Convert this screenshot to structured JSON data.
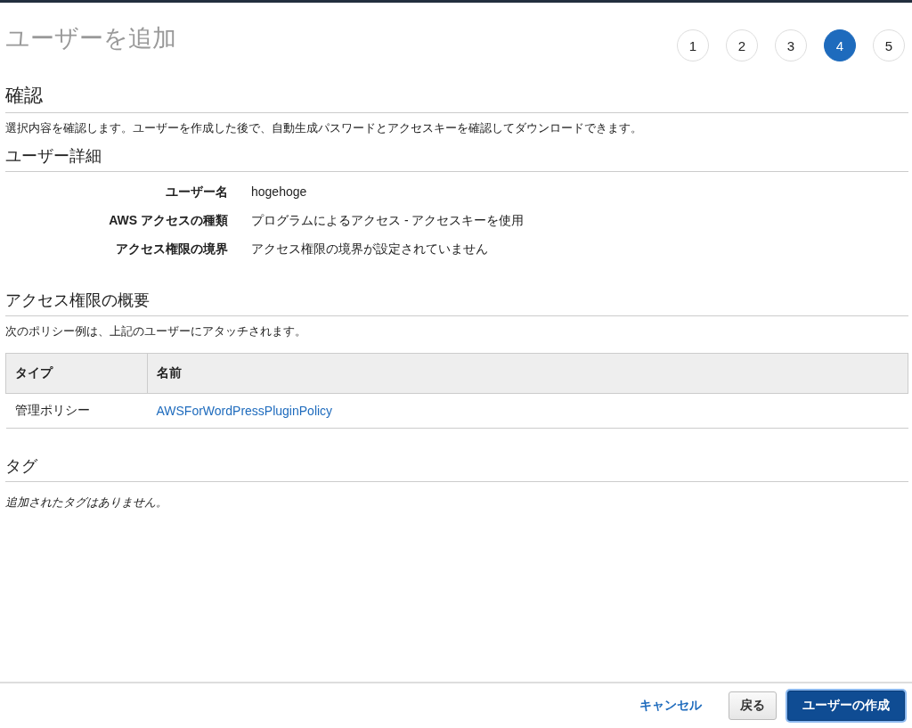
{
  "page_title": "ユーザーを追加",
  "steps": [
    {
      "label": "1",
      "selected": false
    },
    {
      "label": "2",
      "selected": false
    },
    {
      "label": "3",
      "selected": false
    },
    {
      "label": "4",
      "selected": true
    },
    {
      "label": "5",
      "selected": false
    }
  ],
  "review": {
    "heading": "確認",
    "description": "選択内容を確認します。ユーザーを作成した後で、自動生成パスワードとアクセスキーを確認してダウンロードできます。"
  },
  "user_details": {
    "heading": "ユーザー詳細",
    "fields": [
      {
        "label": "ユーザー名",
        "value": "hogehoge"
      },
      {
        "label": "AWS アクセスの種類",
        "value": "プログラムによるアクセス - アクセスキーを使用"
      },
      {
        "label": "アクセス権限の境界",
        "value": "アクセス権限の境界が設定されていません"
      }
    ]
  },
  "permissions": {
    "heading": "アクセス権限の概要",
    "description": "次のポリシー例は、上記のユーザーにアタッチされます。",
    "table": {
      "columns": [
        "タイプ",
        "名前"
      ],
      "rows": [
        {
          "type": "管理ポリシー",
          "name": "AWSForWordPressPluginPolicy"
        }
      ]
    }
  },
  "tags": {
    "heading": "タグ",
    "empty_text": "追加されたタグはありません。"
  },
  "footer": {
    "cancel": "キャンセル",
    "back": "戻る",
    "create": "ユーザーの作成"
  }
}
